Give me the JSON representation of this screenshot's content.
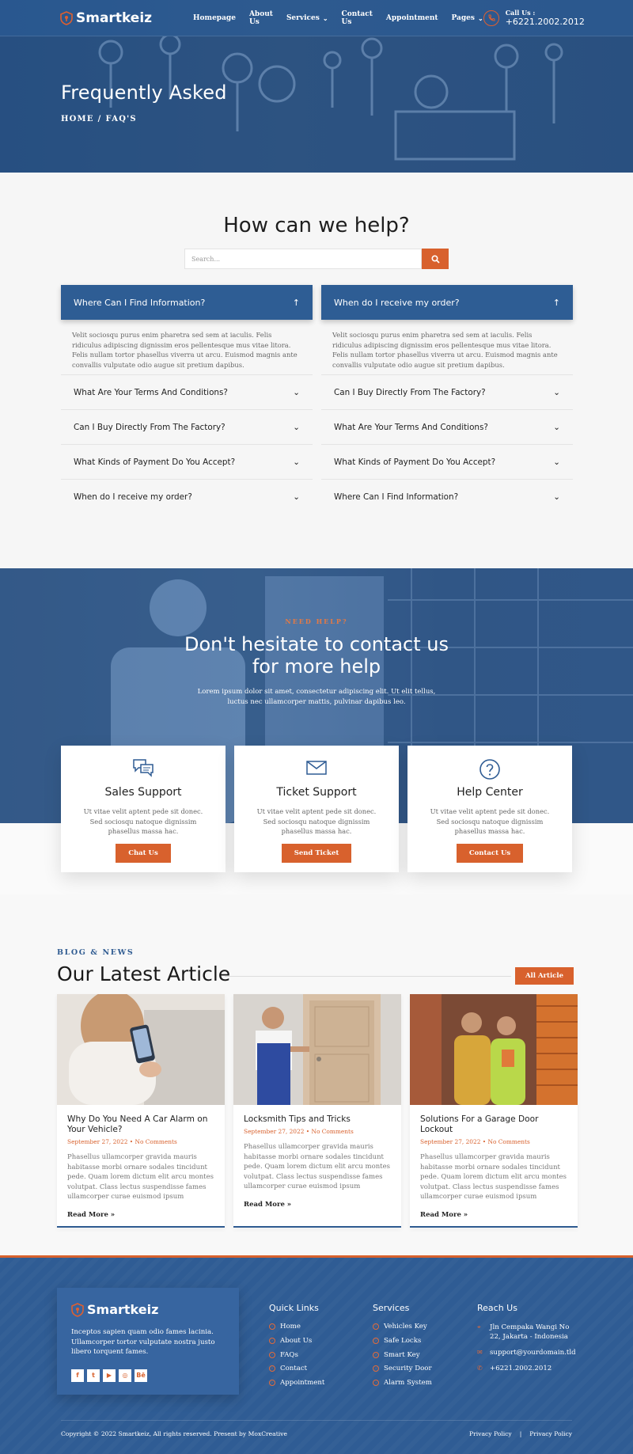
{
  "brand": {
    "name": "Smartkeiz"
  },
  "nav": {
    "items": [
      {
        "label": "Homepage",
        "has_caret": false
      },
      {
        "label": "About Us",
        "has_caret": false
      },
      {
        "label": "Services",
        "has_caret": true
      },
      {
        "label": "Contact Us",
        "has_caret": false
      },
      {
        "label": "Appointment",
        "has_caret": false
      },
      {
        "label": "Pages",
        "has_caret": true
      }
    ],
    "call_label": "Call Us :",
    "call_number": "+6221.2002.2012"
  },
  "hero": {
    "title": "Frequently Asked",
    "breadcrumb": [
      "HOME",
      "/",
      "FAQ'S"
    ]
  },
  "help": {
    "title": "How can we help?",
    "search_placeholder": "Search...",
    "left": {
      "open_question": "Where Can I Find Information?",
      "open_answer": "Velit sociosqu purus enim pharetra sed sem at iaculis. Felis ridiculus adipiscing dignissim eros pellentesque mus vitae litora. Felis nullam tortor phasellus viverra ut arcu. Euismod magnis ante convallis vulputate odio augue sit pretium dapibus.",
      "questions": [
        "What Are Your Terms And Conditions?",
        "Can I Buy Directly From The Factory?",
        "What Kinds of Payment Do You Accept?",
        "When do I receive my order?"
      ]
    },
    "right": {
      "open_question": "When do I receive my order?",
      "open_answer": "Velit sociosqu purus enim pharetra sed sem at iaculis. Felis ridiculus adipiscing dignissim eros pellentesque mus vitae litora. Felis nullam tortor phasellus viverra ut arcu. Euismod magnis ante convallis vulputate odio augue sit pretium dapibus.",
      "questions": [
        "Can I Buy Directly From The Factory?",
        "What Are Your Terms And Conditions?",
        "What Kinds of Payment Do You Accept?",
        "Where Can I Find Information?"
      ]
    }
  },
  "contact": {
    "kicker": "NEED HELP?",
    "title_line1": "Don't hesitate to contact us",
    "title_line2": "for more help",
    "text": "Lorem ipsum dolor sit amet, consectetur adipiscing elit. Ut elit tellus, luctus nec ullamcorper mattis, pulvinar dapibus leo.",
    "cards": [
      {
        "icon": "chat-bubbles-icon",
        "title": "Sales Support",
        "text": "Ut vitae velit aptent pede sit donec. Sed sociosqu natoque dignissim phasellus massa hac.",
        "button": "Chat Us"
      },
      {
        "icon": "envelope-icon",
        "title": "Ticket Support",
        "text": "Ut vitae velit aptent pede sit donec. Sed sociosqu natoque dignissim phasellus massa hac.",
        "button": "Send Ticket"
      },
      {
        "icon": "question-circle-icon",
        "title": "Help Center",
        "text": "Ut vitae velit aptent pede sit donec. Sed sociosqu natoque dignissim phasellus massa hac.",
        "button": "Contact Us"
      }
    ]
  },
  "blog": {
    "kicker": "BLOG & NEWS",
    "title": "Our Latest Article",
    "all_button": "All Article",
    "posts": [
      {
        "image": "car-alarm-phone-photo",
        "title": "Why Do You Need A Car Alarm on Your Vehicle?",
        "date": "September 27, 2022",
        "comments": "No Comments",
        "excerpt": "Phasellus ullamcorper gravida mauris habitasse morbi ornare sodales tincidunt pede. Quam lorem dictum elit arcu montes volutpat. Class lectus suspendisse fames ullamcorper curae euismod ipsum",
        "more": "Read More »"
      },
      {
        "image": "locksmith-door-photo",
        "title": "Locksmith Tips and Tricks",
        "date": "September 27, 2022",
        "comments": "No Comments",
        "excerpt": "Phasellus ullamcorper gravida mauris habitasse morbi ornare sodales tincidunt pede. Quam lorem dictum elit arcu montes volutpat. Class lectus suspendisse fames ullamcorper curae euismod ipsum",
        "more": "Read More »"
      },
      {
        "image": "garage-door-workers-photo",
        "title": "Solutions For a Garage Door Lockout",
        "date": "September 27, 2022",
        "comments": "No Comments",
        "excerpt": "Phasellus ullamcorper gravida mauris habitasse morbi ornare sodales tincidunt pede. Quam lorem dictum elit arcu montes volutpat. Class lectus suspendisse fames ullamcorper curae euismod ipsum",
        "more": "Read More »"
      }
    ]
  },
  "footer": {
    "about": "Inceptos sapien quam odio fames lacinia. Ullamcorper tortor vulputate nostra justo libero torquent fames.",
    "socials": [
      "f",
      "t",
      "▶",
      "◎",
      "Bē"
    ],
    "quick_links": {
      "title": "Quick Links",
      "items": [
        "Home",
        "About Us",
        "FAQs",
        "Contact",
        "Appointment"
      ]
    },
    "services": {
      "title": "Services",
      "items": [
        "Vehicles Key",
        "Safe Locks",
        "Smart Key",
        "Security Door",
        "Alarm System"
      ]
    },
    "reach": {
      "title": "Reach Us",
      "address": "Jln Cempaka Wangi No 22, Jakarta - Indonesia",
      "email": "support@yourdomain.tld",
      "phone": "+6221.2002.2012"
    },
    "copyright": "Copyright © 2022 Smartkeiz, All rights reserved. Present by MoxCreative",
    "bottom_links": [
      "Privacy Policy",
      "|",
      "Privacy Policy"
    ]
  },
  "colors": {
    "primary": "#2f5c94",
    "accent": "#d8612d"
  }
}
